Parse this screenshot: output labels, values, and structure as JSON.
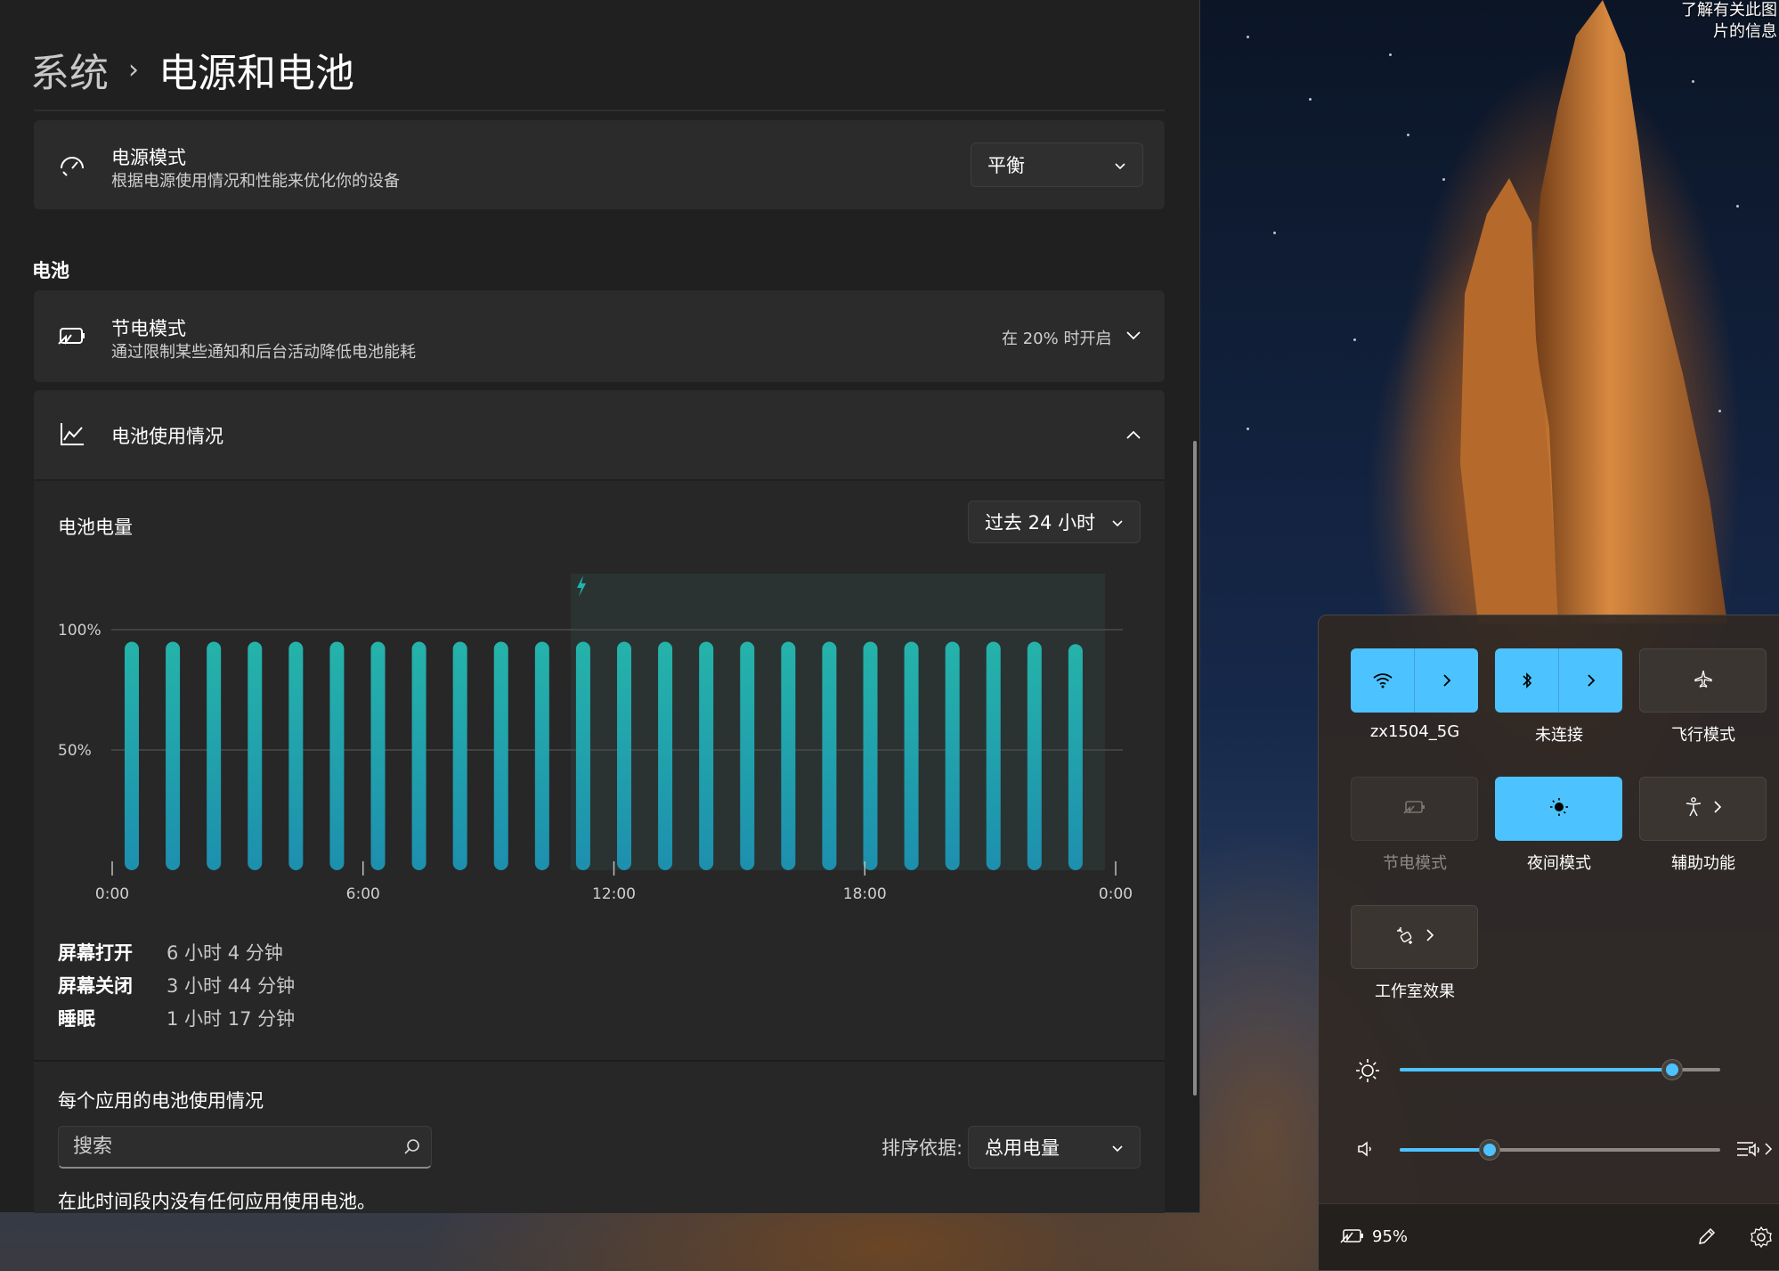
{
  "wallpaper": {
    "about_lines": [
      "了解有关此图",
      "片的信息"
    ]
  },
  "settings": {
    "breadcrumb": {
      "parent": "系统",
      "separator": "›",
      "current": "电源和电池"
    },
    "power_mode": {
      "title": "电源模式",
      "subtitle": "根据电源使用情况和性能来优化你的设备",
      "value": "平衡",
      "icon": "power-mode-icon"
    },
    "battery_section_label": "电池",
    "battery_saver": {
      "title": "节电模式",
      "subtitle": "通过限制某些通知和后台活动降低电池能耗",
      "status": "在 20% 时开启",
      "icon": "battery-saver-icon"
    },
    "battery_usage": {
      "title": "电池使用情况",
      "icon": "line-chart-icon"
    },
    "battery_level": {
      "title": "电池电量",
      "range": "过去 24 小时"
    },
    "chart_data": {
      "type": "bar",
      "title": "电池电量",
      "y_ticks": [
        "100%",
        "50%"
      ],
      "ylim": [
        0,
        100
      ],
      "x_ticks": [
        "0:00",
        "6:00",
        "12:00",
        "18:00",
        "0:00"
      ],
      "values": [
        95,
        95,
        95,
        95,
        95,
        95,
        95,
        95,
        95,
        95,
        95,
        95,
        95,
        95,
        95,
        95,
        95,
        95,
        95,
        95,
        95,
        95,
        95,
        94
      ],
      "charging_start_fraction": 0.4583,
      "accent_color": "#1fb4ad"
    },
    "stats": [
      {
        "label": "屏幕打开",
        "value": "6 小时 4 分钟"
      },
      {
        "label": "屏幕关闭",
        "value": "3 小时 44 分钟"
      },
      {
        "label": "睡眠",
        "value": "1 小时 17 分钟"
      }
    ],
    "per_app": {
      "title": "每个应用的电池使用情况",
      "search_placeholder": "搜索",
      "sort_label": "排序依据:",
      "sort_value": "总用电量",
      "empty_message": "在此时间段内没有任何应用使用电池。"
    }
  },
  "quick_settings": {
    "tiles": [
      {
        "label": "zx1504_5G",
        "state": "on",
        "icon": "wifi-icon"
      },
      {
        "label": "未连接",
        "state": "on",
        "icon": "bluetooth-icon"
      },
      {
        "label": "飞行模式",
        "state": "off",
        "icon": "airplane-icon"
      },
      {
        "label": "节电模式",
        "state": "disabled",
        "icon": "battery-saver-icon"
      },
      {
        "label": "夜间模式",
        "state": "on",
        "icon": "night-light-icon"
      },
      {
        "label": "辅助功能",
        "state": "off",
        "icon": "accessibility-icon"
      },
      {
        "label": "工作室效果",
        "state": "off",
        "icon": "studio-effects-icon"
      }
    ],
    "brightness_percent": 85,
    "volume_percent": 28,
    "battery_percent": "95%",
    "accent_color": "#4cc2ff"
  }
}
